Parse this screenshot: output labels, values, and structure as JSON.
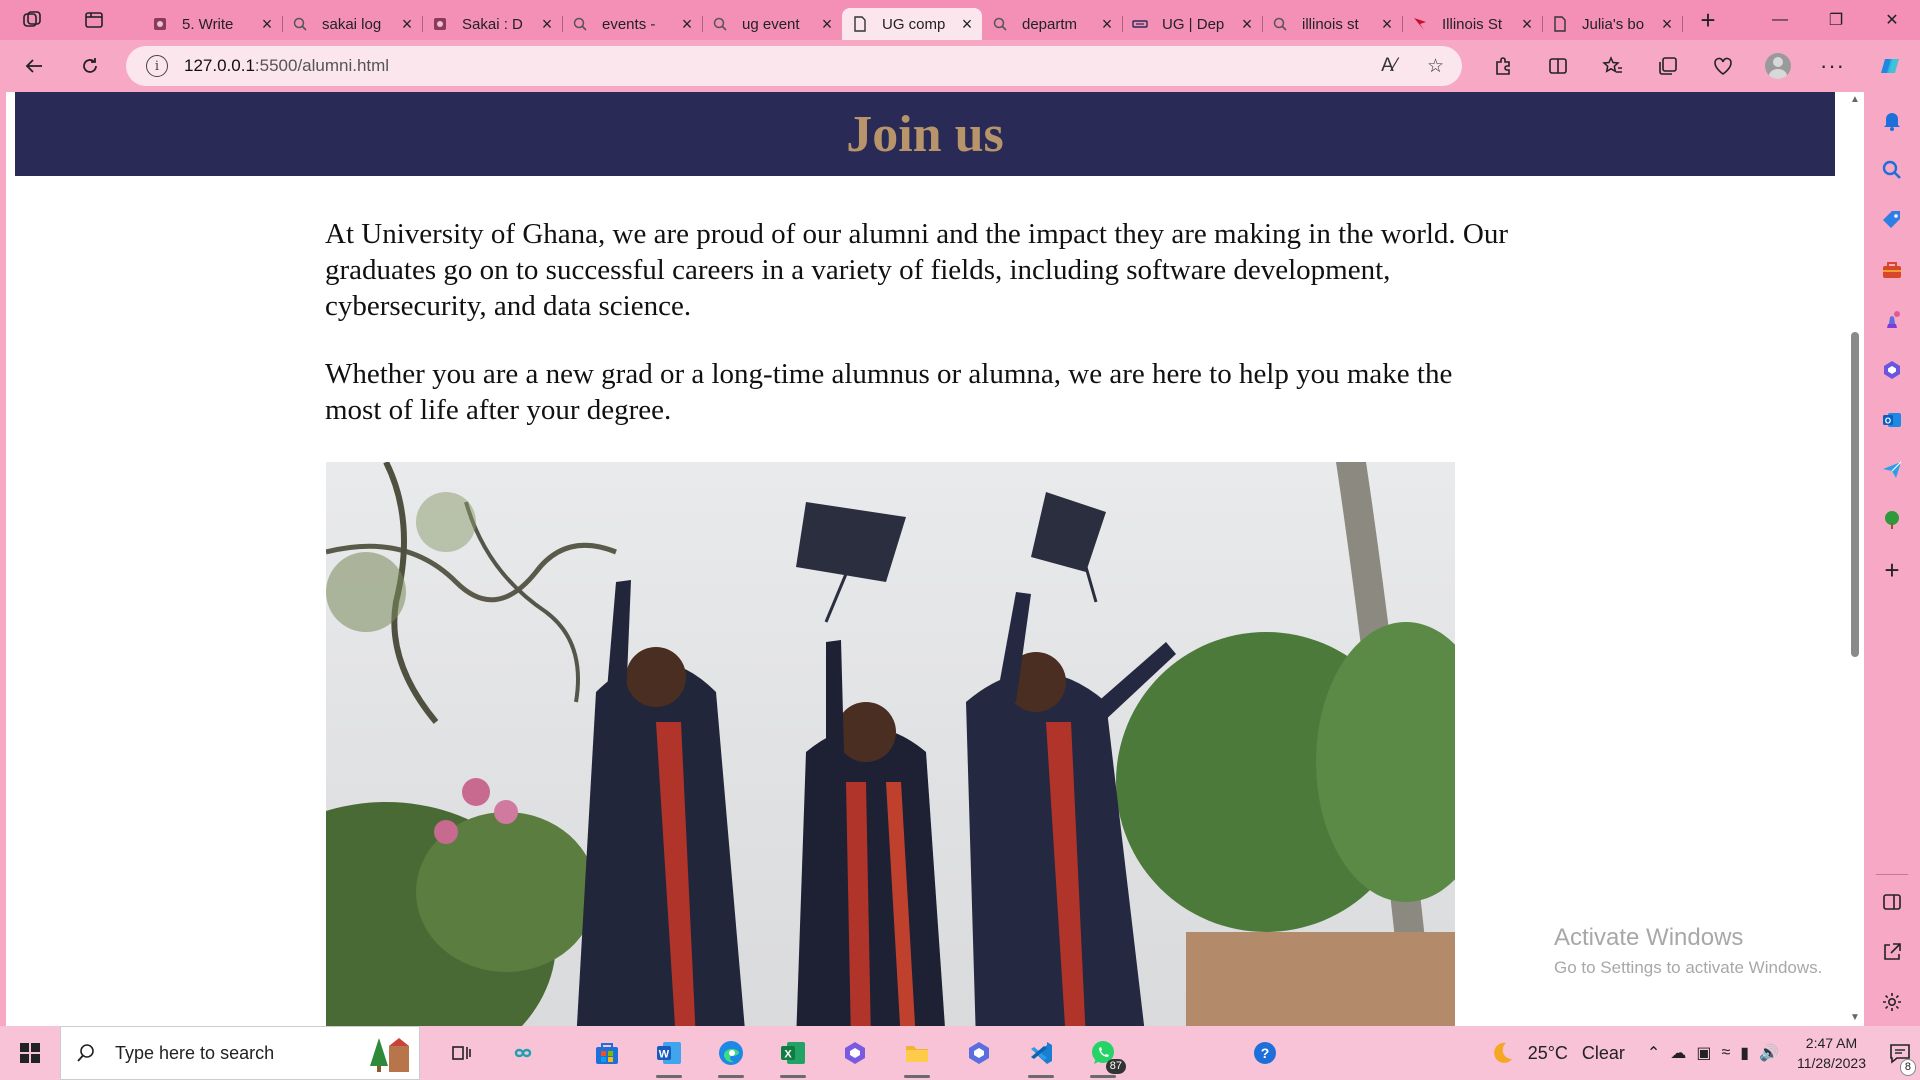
{
  "browser": {
    "tabs": [
      {
        "title": "5. Write",
        "icon": "sakai-icon"
      },
      {
        "title": "sakai log",
        "icon": "search-icon"
      },
      {
        "title": "Sakai : D",
        "icon": "sakai-icon"
      },
      {
        "title": "events -",
        "icon": "search-icon"
      },
      {
        "title": "ug event",
        "icon": "search-icon"
      },
      {
        "title": "UG comp",
        "icon": "page-icon"
      },
      {
        "title": "departm",
        "icon": "search-icon"
      },
      {
        "title": "UG | Dep",
        "icon": "ug-icon"
      },
      {
        "title": "illinois st",
        "icon": "search-icon"
      },
      {
        "title": "Illinois St",
        "icon": "illinois-icon"
      },
      {
        "title": "Julia's bo",
        "icon": "page-icon"
      }
    ],
    "active_tab_index": 5,
    "address": {
      "host": "127.0.0.1",
      "path": ":5500/alumni.html"
    },
    "accent": "#f490b6"
  },
  "page": {
    "heading": "Join us",
    "paragraphs": [
      "At University of Ghana, we are proud of our alumni and the impact they are making in the world. Our graduates go on to successful careers in a variety of fields, including software development, cybersecurity, and data science.",
      "Whether you are a new grad or a long-time alumnus or alumna, we are here to help you make the most of life after your degree."
    ],
    "hero_bg": "#2a2a57",
    "heading_color": "#b8946a"
  },
  "watermark": {
    "line1": "Activate Windows",
    "line2": "Go to Settings to activate Windows."
  },
  "taskbar": {
    "search_placeholder": "Type here to search",
    "whatsapp_badge": "87",
    "weather_temp": "25°C",
    "weather_cond": "Clear",
    "time": "2:47 AM",
    "date": "11/28/2023",
    "notification_count": "8"
  }
}
